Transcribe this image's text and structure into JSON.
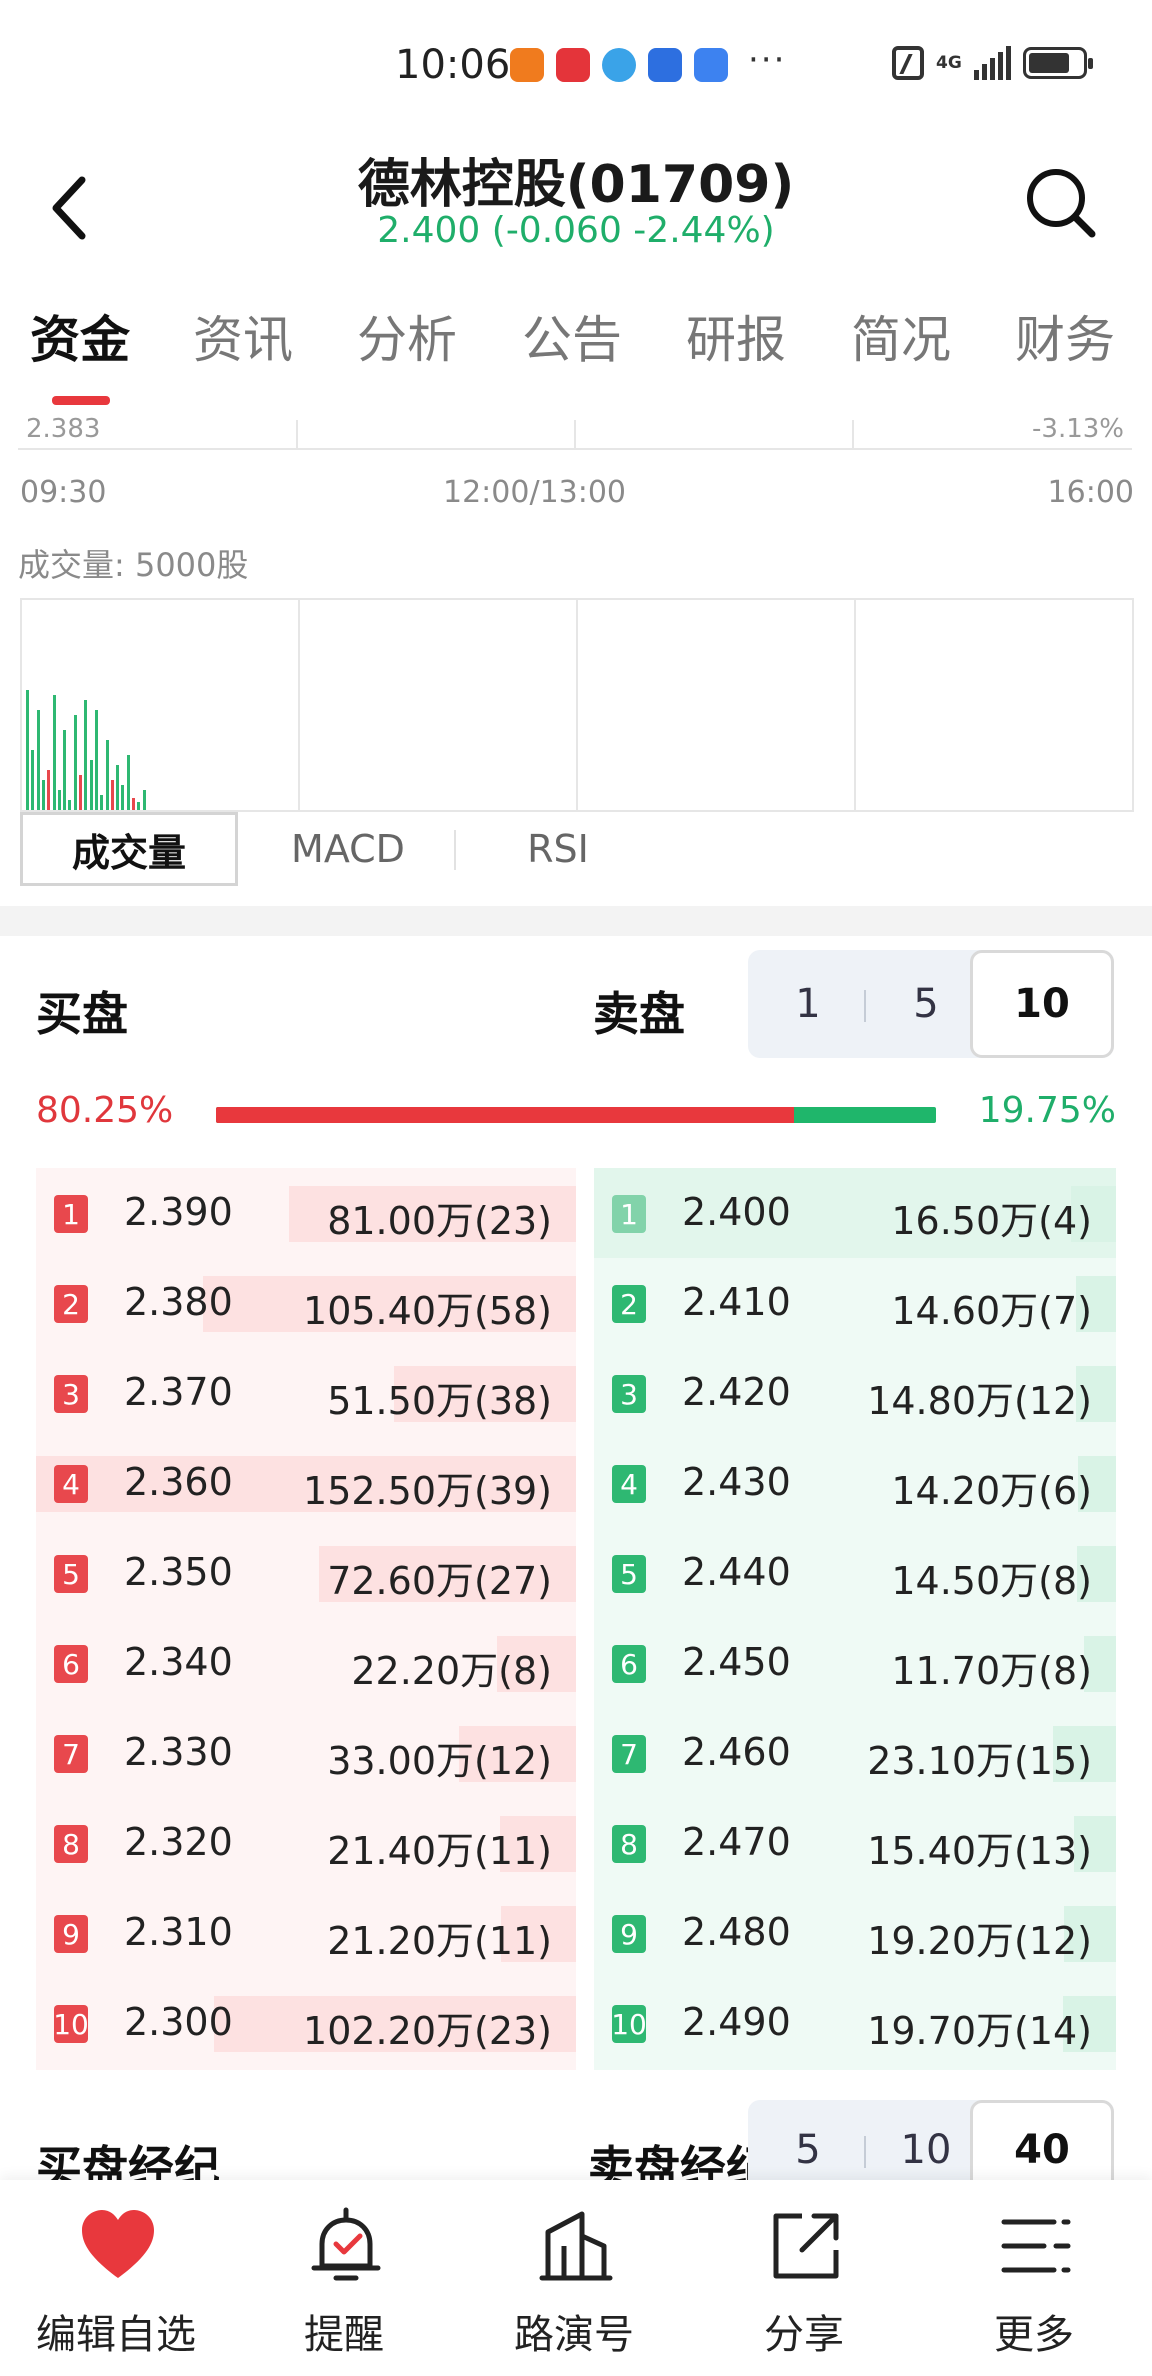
{
  "status_bar": {
    "time": "10:06",
    "network": "4G",
    "battery_level": 0.78
  },
  "header": {
    "title": "德林控股(01709)",
    "quote": "2.400 (-0.060 -2.44%)",
    "quote_color": "#1fae6a"
  },
  "tabs": [
    {
      "label": "资金",
      "active": true
    },
    {
      "label": "资讯"
    },
    {
      "label": "分析"
    },
    {
      "label": "公告"
    },
    {
      "label": "研报"
    },
    {
      "label": "简况"
    },
    {
      "label": "财务"
    }
  ],
  "chart": {
    "top_left_value": "2.383",
    "top_right_value": "-3.13%",
    "time_axis": [
      "09:30",
      "12:00/13:00",
      "16:00"
    ],
    "volume_label": "成交量: 5000股",
    "indicator_tabs": [
      "成交量",
      "MACD",
      "RSI"
    ]
  },
  "order_book": {
    "buy_title": "买盘",
    "sell_title": "卖盘",
    "depth_options": [
      "1",
      "5",
      "10"
    ],
    "depth_selected": "10",
    "buy_ratio": "80.25%",
    "sell_ratio": "19.75%",
    "buy_ratio_value": 0.8025,
    "buy_color": "#e8383d",
    "sell_color": "#1fb66b",
    "bids": [
      {
        "level": "1",
        "price": "2.390",
        "volume": "81.00万(23)",
        "vol_wan": 81.0
      },
      {
        "level": "2",
        "price": "2.380",
        "volume": "105.40万(58)",
        "vol_wan": 105.4
      },
      {
        "level": "3",
        "price": "2.370",
        "volume": "51.50万(38)",
        "vol_wan": 51.5
      },
      {
        "level": "4",
        "price": "2.360",
        "volume": "152.50万(39)",
        "vol_wan": 152.5
      },
      {
        "level": "5",
        "price": "2.350",
        "volume": "72.60万(27)",
        "vol_wan": 72.6
      },
      {
        "level": "6",
        "price": "2.340",
        "volume": "22.20万(8)",
        "vol_wan": 22.2
      },
      {
        "level": "7",
        "price": "2.330",
        "volume": "33.00万(12)",
        "vol_wan": 33.0
      },
      {
        "level": "8",
        "price": "2.320",
        "volume": "21.40万(11)",
        "vol_wan": 21.4
      },
      {
        "level": "9",
        "price": "2.310",
        "volume": "21.20万(11)",
        "vol_wan": 21.2
      },
      {
        "level": "10",
        "price": "2.300",
        "volume": "102.20万(23)",
        "vol_wan": 102.2
      }
    ],
    "asks": [
      {
        "level": "1",
        "price": "2.400",
        "volume": "16.50万(4)",
        "vol_wan": 16.5
      },
      {
        "level": "2",
        "price": "2.410",
        "volume": "14.60万(7)",
        "vol_wan": 14.6
      },
      {
        "level": "3",
        "price": "2.420",
        "volume": "14.80万(12)",
        "vol_wan": 14.8
      },
      {
        "level": "4",
        "price": "2.430",
        "volume": "14.20万(6)",
        "vol_wan": 14.2
      },
      {
        "level": "5",
        "price": "2.440",
        "volume": "14.50万(8)",
        "vol_wan": 14.5
      },
      {
        "level": "6",
        "price": "2.450",
        "volume": "11.70万(8)",
        "vol_wan": 11.7
      },
      {
        "level": "7",
        "price": "2.460",
        "volume": "23.10万(15)",
        "vol_wan": 23.1
      },
      {
        "level": "8",
        "price": "2.470",
        "volume": "15.40万(13)",
        "vol_wan": 15.4
      },
      {
        "level": "9",
        "price": "2.480",
        "volume": "19.20万(12)",
        "vol_wan": 19.2
      },
      {
        "level": "10",
        "price": "2.490",
        "volume": "19.70万(14)",
        "vol_wan": 19.7
      }
    ]
  },
  "broker": {
    "buy_title": "买盘经纪",
    "sell_title": "卖盘经纪",
    "options": [
      "5",
      "10",
      "40"
    ],
    "selected": "40"
  },
  "bottom_nav": [
    {
      "label": "编辑自选",
      "icon": "heart-icon"
    },
    {
      "label": "提醒",
      "icon": "alarm-bell-icon"
    },
    {
      "label": "路演号",
      "icon": "building-icon"
    },
    {
      "label": "分享",
      "icon": "share-icon"
    },
    {
      "label": "更多",
      "icon": "more-menu-icon"
    }
  ]
}
